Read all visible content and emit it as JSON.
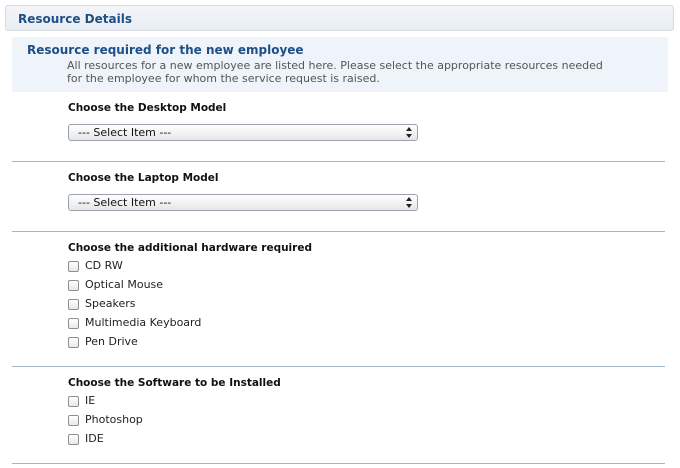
{
  "header": {
    "title": "Resource Details"
  },
  "info": {
    "title": "Resource required for the new employee",
    "line1": "All resources for a new employee are listed here. Please select the appropriate resources needed",
    "line2": "for the employee for whom the service request is raised."
  },
  "desktop": {
    "label": "Choose the Desktop Model",
    "selected": "--- Select Item ---"
  },
  "laptop": {
    "label": "Choose the Laptop Model",
    "selected": "--- Select Item ---"
  },
  "hardware": {
    "label": "Choose the additional hardware required",
    "items": [
      "CD RW",
      "Optical Mouse",
      "Speakers",
      "Multimedia Keyboard",
      "Pen Drive"
    ]
  },
  "software": {
    "label": "Choose the Software to be Installed",
    "items": [
      "IE",
      "Photoshop",
      "IDE"
    ]
  }
}
